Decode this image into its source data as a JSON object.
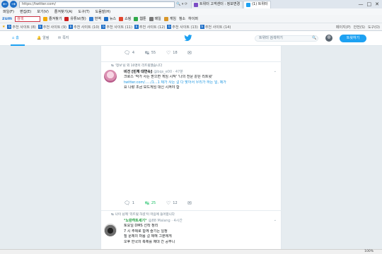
{
  "browser": {
    "address": "https://twitter.com/",
    "tabs": [
      {
        "label": "트위터 고객센터 : 정보변경",
        "color": "#7b4cc4"
      },
      {
        "label": "(1) 트위터",
        "color": "#1da1f2"
      }
    ],
    "menu": [
      "파일(F)",
      "편집(E)",
      "보기(V)",
      "즐겨찾기(A)",
      "도구(T)",
      "도움말(H)"
    ],
    "toolbar": {
      "search_label": "검색",
      "items": [
        {
          "label": "즐겨찾기",
          "color": "#f2a900"
        },
        {
          "label": "유튜브(첫)",
          "color": "#cc1f1f"
        },
        {
          "label": "번역",
          "color": "#2d7bd3"
        },
        {
          "label": "뉴스",
          "color": "#1f6fc7"
        },
        {
          "label": "쇼핑",
          "color": "#e0472f"
        },
        {
          "label": "웹툰",
          "color": "#2faa4a"
        },
        {
          "label": "메일",
          "color": "#777777"
        },
        {
          "label": "게임",
          "color": "#d8962a"
        },
        {
          "label": "청소"
        },
        {
          "label": "하이퍼"
        }
      ]
    },
    "favorites": [
      "추천 사이트 (8)",
      "추천 사이트 (9)",
      "추천 사이트 (10)",
      "추천 사이트 (11)",
      "추천 사이트 (12)",
      "추천 사이트 (13)",
      "추천 사이트 (14)"
    ],
    "favorites_right": [
      "페이지(P)",
      "안전(S)",
      "도구(O)"
    ],
    "zoom": "100%"
  },
  "twitter": {
    "nav": {
      "home": "홈",
      "notifications": "알림",
      "messages": "쪽지"
    },
    "search_placeholder": "트위터 검색하기",
    "tweet_button": "트윗하기",
    "top_actions": {
      "reply": "4",
      "retweet": "55",
      "like": "18"
    },
    "tweet1": {
      "context": "'정보'님 외 10명이 리트윗했습니다",
      "name": "비건 [빈체 대연속]",
      "meta": "@bqs_e00 · 47분",
      "lines": [
        "크로스 '작가 사는 받으면 게임 시작' '나의 전문 같은 리트윗'",
        "twitter.com/...../1...1  제가 사는 걸 다 맞아서 우리가 하는 일, 제가",
        "요 나랑 조금 보드게임 대신 시켜야 함"
      ],
      "actions": {
        "reply": "1",
        "retweet": "25",
        "like": "12"
      }
    },
    "tweet2": {
      "context": "나이 님께 '리트윗 하셨'이 마음에 들어합니다",
      "name": "°노란하트세기°",
      "meta": "@88 Malang · 4시간",
      "lines": [
        "토요일 DMS 선착 정리",
        "7 시 주제로 함께 즐기는 일정",
        "질 문제의 마음 걸 제해 그분에게",
        "오후 한국의 축제를 제대 간 공부니"
      ]
    }
  }
}
